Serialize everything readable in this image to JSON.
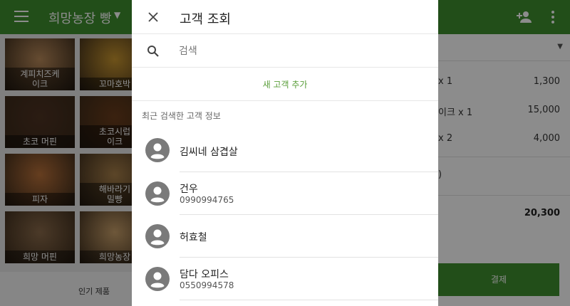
{
  "app": {
    "store_name": "희망농장 빵",
    "colors": {
      "primary": "#3e8e2f",
      "accent_link": "#5a9e3a",
      "scrim": "rgba(0,0,0,0.45)"
    }
  },
  "products": [
    {
      "label": "계피치즈케이크",
      "label_line1": "계피치즈케",
      "label_line2": "이크",
      "color": "#b98a5a"
    },
    {
      "label": "꼬마호박",
      "label_line1": "꼬마호박",
      "label_line2": "",
      "color": "#c9962f"
    },
    {
      "label": "초코 머핀",
      "label_line1": "초코 머핀",
      "label_line2": "",
      "color": "#4e3322"
    },
    {
      "label": "초코시럽 케이크",
      "label_line1": "초코시럽",
      "label_line2": "이크",
      "color": "#6b3d1c"
    },
    {
      "label": "피자",
      "label_line1": "피자",
      "label_line2": "",
      "color": "#b9713a"
    },
    {
      "label": "해바라기 통밀빵",
      "label_line1": "해바라기",
      "label_line2": "밀빵",
      "color": "#a8804a"
    },
    {
      "label": "희망 머핀",
      "label_line1": "희망 머핀",
      "label_line2": "",
      "color": "#8a6a4a"
    },
    {
      "label": "희망농장",
      "label_line1": "희망농장",
      "label_line2": "",
      "color": "#c9a06a"
    }
  ],
  "bottom_tab": {
    "popular_label": "인기 제품"
  },
  "order": {
    "lines": [
      {
        "qty_text": "x 1",
        "amount": "1,300"
      },
      {
        "qty_text": "이크 x 1",
        "amount": "15,000"
      },
      {
        "qty_text": "x 2",
        "amount": "4,000"
      }
    ],
    "misc_text": ")",
    "total": "20,300",
    "pay_label": "결제"
  },
  "dialog": {
    "title": "고객 조회",
    "search_placeholder": "검색",
    "add_customer_label": "새 고객 추가",
    "recent_header": "최근 검색한 고객 정보",
    "customers": [
      {
        "name": "김씨네 삼겹살",
        "phone": ""
      },
      {
        "name": "건우",
        "phone": "0990994765"
      },
      {
        "name": "허효철",
        "phone": ""
      },
      {
        "name": "담다 오피스",
        "phone": "0550994578"
      }
    ]
  },
  "icons": {
    "menu": "menu-icon",
    "add_person": "add-person-icon",
    "more": "more-vert-icon",
    "close": "close-icon",
    "search": "search-icon",
    "avatar": "account-circle-icon"
  }
}
